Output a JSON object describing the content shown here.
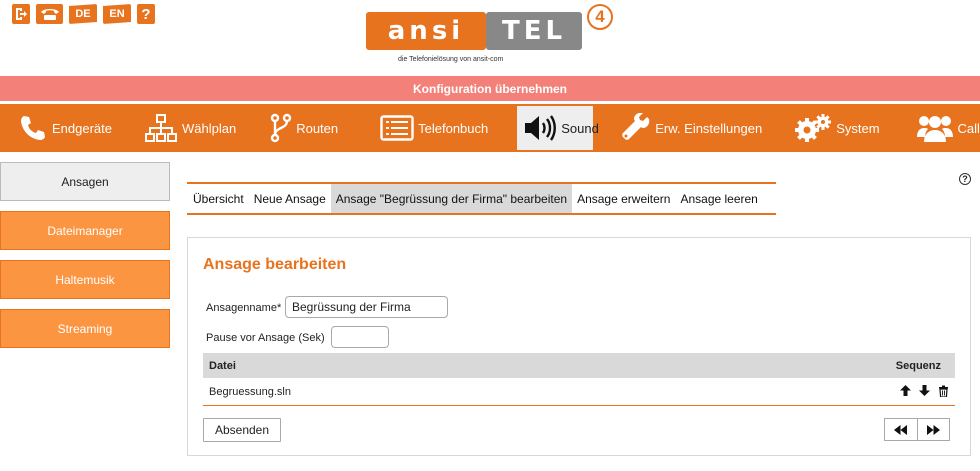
{
  "top_icons": {
    "logout": "logout-icon",
    "phone": "phone-icon",
    "lang_de": "DE",
    "lang_en": "EN",
    "help": "?"
  },
  "logo": {
    "left_text": "ansi",
    "right_text": "TEL",
    "version": "4",
    "tagline": "die Telefonielösung von ansit-com"
  },
  "apply_bar": {
    "label": "Konfiguration übernehmen"
  },
  "main_nav": [
    {
      "label": "Endgeräte",
      "icon": "phone-handset-icon"
    },
    {
      "label": "Wählplan",
      "icon": "sitemap-icon"
    },
    {
      "label": "Routen",
      "icon": "route-icon"
    },
    {
      "label": "Telefonbuch",
      "icon": "phonebook-icon"
    },
    {
      "label": "Sound",
      "icon": "speaker-icon",
      "active": true
    },
    {
      "label": "Erw. Einstellungen",
      "icon": "wrench-icon"
    },
    {
      "label": "System",
      "icon": "gears-icon"
    },
    {
      "label": "Callcenter",
      "icon": "users-icon"
    }
  ],
  "sidebar": [
    {
      "label": "Ansagen",
      "active": true
    },
    {
      "label": "Dateimanager"
    },
    {
      "label": "Haltemusik"
    },
    {
      "label": "Streaming"
    }
  ],
  "help_icon": "?",
  "sub_tabs": [
    {
      "label": "Übersicht"
    },
    {
      "label": "Neue Ansage"
    },
    {
      "label": "Ansage \"Begrüssung der Firma\" bearbeiten",
      "active": true
    },
    {
      "label": "Ansage erweitern"
    },
    {
      "label": "Ansage leeren"
    }
  ],
  "panel": {
    "title": "Ansage bearbeiten",
    "name_label": "Ansagenname*",
    "name_value": "Begrüssung der Firma",
    "pause_label": "Pause vor Ansage (Sek)",
    "pause_value": "",
    "table": {
      "col_file": "Datei",
      "col_seq": "Sequenz",
      "rows": [
        {
          "file": "Begruessung.sln"
        }
      ]
    },
    "submit_label": "Absenden",
    "pager_prev": "◀◀",
    "pager_next": "▶▶"
  },
  "colors": {
    "accent": "#e8731f",
    "apply_bar": "#f38079",
    "sidebar_item": "#fc9541",
    "active_bg": "#eeeeee"
  }
}
